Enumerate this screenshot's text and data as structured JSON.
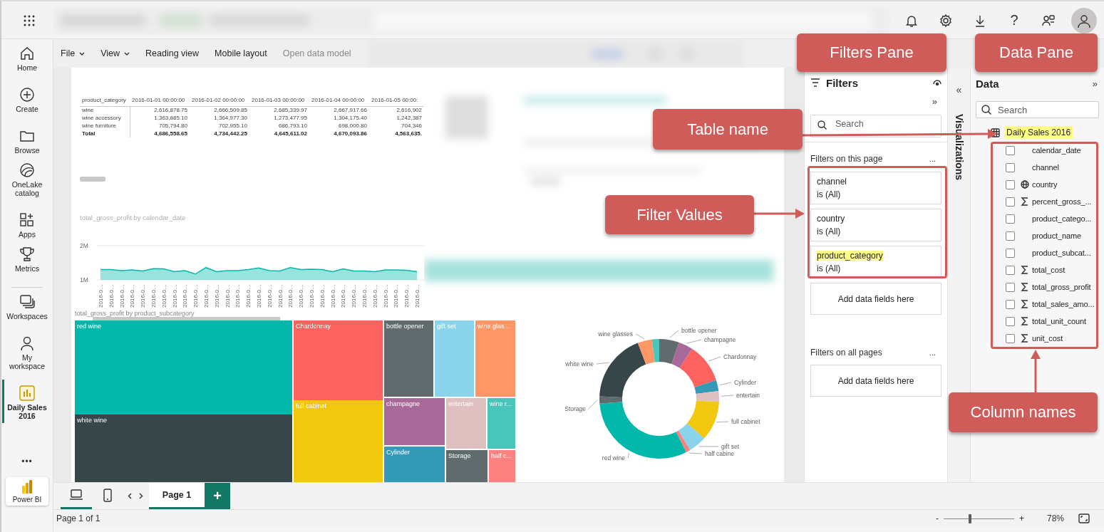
{
  "top_bar": {
    "help": "?"
  },
  "nav": {
    "items": [
      {
        "label": "Home",
        "selected": false
      },
      {
        "label": "Create",
        "selected": false
      },
      {
        "label": "Browse",
        "selected": false
      },
      {
        "label": "OneLake catalog",
        "selected": false
      },
      {
        "label": "Apps",
        "selected": false
      },
      {
        "label": "Metrics",
        "selected": false
      },
      {
        "label": "Workspaces",
        "selected": false
      },
      {
        "label": "My workspace",
        "selected": false
      },
      {
        "label": "Daily Sales 2016",
        "selected": true
      }
    ],
    "more": "•••",
    "app": "Power BI"
  },
  "toolbar": {
    "items": [
      {
        "label": "File",
        "dropdown": true,
        "disabled": false
      },
      {
        "label": "View",
        "dropdown": true,
        "disabled": false
      },
      {
        "label": "Reading view",
        "dropdown": false,
        "disabled": false
      },
      {
        "label": "Mobile layout",
        "dropdown": false,
        "disabled": false
      },
      {
        "label": "Open data model",
        "dropdown": false,
        "disabled": true
      }
    ]
  },
  "report": {
    "matrix": {
      "columns": [
        "product_category",
        "2016-01-01 00:00:00",
        "2016-01-02 00:00:00",
        "2016-01-03 00:00:00",
        "2016-01-04 00:00:00",
        "2016-01-05 00:00:"
      ],
      "rows": [
        {
          "cells": [
            "wine",
            "2,616,878.75",
            "2,666,509.85",
            "2,685,339.97",
            "2,667,917.66",
            "2,616,902"
          ],
          "total": false
        },
        {
          "cells": [
            "wine accessory",
            "1,363,885.10",
            "1,364,977.30",
            "1,273,477.95",
            "1,304,175.40",
            "1,242,387"
          ],
          "total": false
        },
        {
          "cells": [
            "wine furniture",
            "705,794.80",
            "702,955.10",
            "686,793.10",
            "698,000.80",
            "704,346"
          ],
          "total": false
        },
        {
          "cells": [
            "Total",
            "4,686,558.65",
            "4,734,442.25",
            "4,645,611.02",
            "4,670,093.86",
            "4,563,635."
          ],
          "total": true
        }
      ]
    },
    "line_chart": {
      "chart_data": {
        "type": "area",
        "title": "total_gross_profit by calendar_date",
        "categories": [
          "2016-0…",
          "2016-0…",
          "2016-0…",
          "2016-0…",
          "2016-0…",
          "2016-0…",
          "2016-0…",
          "2016-0…",
          "2016-0…",
          "2016-0…",
          "2016-0…",
          "2016-0…",
          "2016-0…",
          "2016-0…",
          "2016-0…",
          "2016-0…",
          "2016-0…",
          "2016-0…",
          "2016-0…",
          "2016-0…",
          "2016-0…",
          "2016-0…",
          "2016-0…",
          "2016-0…",
          "2016-0…",
          "2016-0…",
          "2016-0…",
          "2016-0…",
          "2016-0…",
          "2016-0…",
          "2016-0…"
        ],
        "series": [
          {
            "color": "#01b8aa",
            "values": [
              1300000,
              1300000,
              1270000,
              1290000,
              1260000,
              1330000,
              1320000,
              1240000,
              1270000,
              1170000,
              1360000,
              1240000,
              1270000,
              1270000,
              1300000,
              1350000,
              1270000,
              1260000,
              1360000,
              1300000,
              1310000,
              1300000,
              1240000,
              1320000,
              1260000,
              1260000,
              1240000,
              1290000,
              1290000,
              1280000,
              1240000
            ]
          }
        ],
        "ylim": [
          1000000,
          2000000
        ],
        "yticks": [
          {
            "value": 1000000,
            "label": "1M"
          },
          {
            "value": 2000000,
            "label": "2M"
          }
        ]
      }
    },
    "treemap": {
      "title": "total_gross_profit by product_subcategory",
      "tiles": [
        {
          "label": "red wine",
          "color": "#01b8aa"
        },
        {
          "label": "white wine",
          "color": "#374649"
        },
        {
          "label": "Chardonnay",
          "color": "#fd625e"
        },
        {
          "label": "full cabinet",
          "color": "#f2c80f"
        },
        {
          "label": "bottle opener",
          "color": "#5f6b6d"
        },
        {
          "label": "gift set",
          "color": "#8ad4eb"
        },
        {
          "label": "wine glas...",
          "color": "#fe9666"
        },
        {
          "label": "champagne",
          "color": "#a66999"
        },
        {
          "label": "entertain",
          "color": "#dfbfbf"
        },
        {
          "label": "wine r...",
          "color": "#4ac5bb"
        },
        {
          "label": "Cylinder",
          "color": "#3599b8"
        },
        {
          "label": "Storage",
          "color": "#5f6b6d"
        },
        {
          "label": "half c...",
          "color": "#fb8281"
        }
      ]
    },
    "donut": {
      "slices": [
        {
          "label": "bottle opener",
          "color": "#5f6b6d"
        },
        {
          "label": "champagne",
          "color": "#a66999"
        },
        {
          "label": "Chardonnay",
          "color": "#fd625e"
        },
        {
          "label": "Cylinder",
          "color": "#3599b8"
        },
        {
          "label": "entertain",
          "color": "#dfbfbf"
        },
        {
          "label": "full cabinet",
          "color": "#f2c80f"
        },
        {
          "label": "gift set",
          "color": "#8ad4eb"
        },
        {
          "label": "half cabine",
          "color": "#fb8281"
        },
        {
          "label": "red wine",
          "color": "#01b8aa"
        },
        {
          "label": "Storage",
          "color": "#5f6b6d"
        },
        {
          "label": "white wine",
          "color": "#374649"
        },
        {
          "label": "wine glasses",
          "color": "#fe9666"
        },
        {
          "color": "#4ac5bb"
        }
      ]
    }
  },
  "filters": {
    "title": "Filters",
    "expand": "»",
    "search": {
      "placeholder": "Search"
    },
    "page_section": {
      "title": "Filters on this page",
      "more": "...",
      "cards": [
        {
          "field": "channel",
          "condition": "is (All)",
          "highlighted": false
        },
        {
          "field": "country",
          "condition": "is (All)",
          "highlighted": false
        },
        {
          "field": "product_category",
          "condition": "is (All)",
          "highlighted": true
        }
      ],
      "drop_zone": "Add data fields here"
    },
    "all_pages_section": {
      "title": "Filters on all pages",
      "more": "...",
      "drop_zone": "Add data fields here"
    }
  },
  "visualizations": {
    "title": "Visualizations",
    "collapse": "«"
  },
  "data_pane": {
    "title": "Data",
    "expand": "»",
    "search": {
      "placeholder": "Search"
    },
    "table": {
      "name": "Daily Sales 2016",
      "highlighted": true,
      "columns": [
        {
          "name": "calendar_date",
          "kind": "plain",
          "checked": false
        },
        {
          "name": "channel",
          "kind": "plain",
          "checked": false
        },
        {
          "name": "country",
          "kind": "geo",
          "checked": false
        },
        {
          "name": "percent_gross_...",
          "kind": "measure",
          "checked": false
        },
        {
          "name": "product_catego...",
          "kind": "plain",
          "checked": false
        },
        {
          "name": "product_name",
          "kind": "plain",
          "checked": false
        },
        {
          "name": "product_subcat...",
          "kind": "plain",
          "checked": false
        },
        {
          "name": "total_cost",
          "kind": "measure",
          "checked": false
        },
        {
          "name": "total_gross_profit",
          "kind": "measure",
          "checked": false
        },
        {
          "name": "total_sales_amo...",
          "kind": "measure",
          "checked": false
        },
        {
          "name": "total_unit_count",
          "kind": "measure",
          "checked": false
        },
        {
          "name": "unit_cost",
          "kind": "measure",
          "checked": false
        }
      ]
    }
  },
  "pages": {
    "views": [
      {
        "kind": "desktop",
        "selected": true
      },
      {
        "kind": "mobile",
        "selected": false
      }
    ],
    "tabs": [
      {
        "label": "Page 1",
        "selected": true
      }
    ],
    "add": "+"
  },
  "status_bar": {
    "page_info": "Page 1 of 1",
    "zoom": {
      "minus": "-",
      "plus": "+",
      "level": 0.37,
      "reading": "78%"
    }
  },
  "callouts": [
    {
      "label": "Filters Pane"
    },
    {
      "label": "Data Pane"
    },
    {
      "label": "Table name"
    },
    {
      "label": "Filter Values"
    },
    {
      "label": "Column names"
    }
  ]
}
